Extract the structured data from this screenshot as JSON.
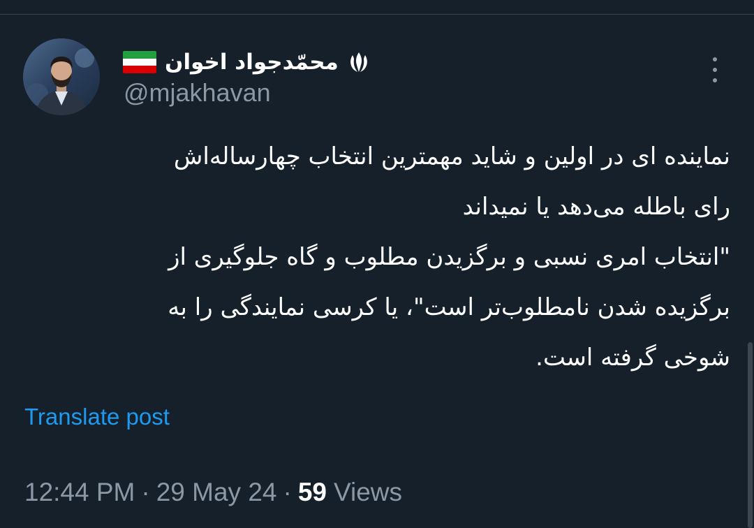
{
  "author": {
    "display_name": "محمّدجواد اخوان",
    "handle": "@mjakhavan",
    "emblem_icon": "iran-emblem-icon",
    "flag_icon": "iran-flag-icon",
    "flag_colors": [
      "#239f40",
      "#ffffff",
      "#da0000"
    ]
  },
  "tweet": {
    "lines": [
      "نماینده ای در اولین و شاید مهمترین انتخاب چهارساله‌اش",
      "رای باطله می‌دهد یا نمیداند",
      "\"انتخاب امری نسبی و برگزیدن مطلوب و گاه جلوگیری از",
      "برگزیده شدن نامطلوب‌تر است\"، یا کرسی نمایندگی را به",
      "شوخی گرفته است."
    ]
  },
  "translate_label": "Translate post",
  "meta": {
    "time": "12:44 PM",
    "separator": "·",
    "date": "29 May 24",
    "views_count": "59",
    "views_label": "Views"
  },
  "colors": {
    "background": "#15202b",
    "text": "#ffffff",
    "muted": "#8b98a5",
    "link": "#1d9bf0"
  }
}
